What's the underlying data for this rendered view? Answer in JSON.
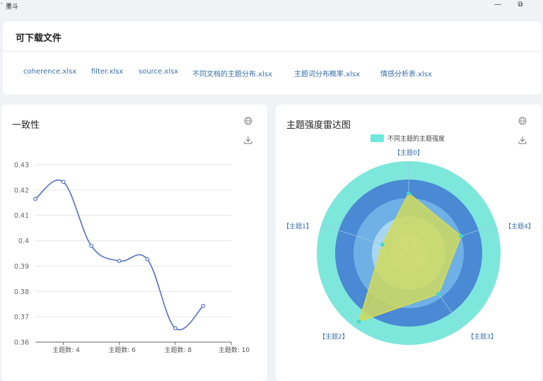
{
  "window": {
    "title": "墨斗",
    "min_icon": "—",
    "restore_icon": "⧉"
  },
  "files": {
    "title": "可下载文件",
    "links": [
      "coherence.xlsx",
      "filter.xlsx",
      "source.xlsx",
      "不同文档的主题分布.xlsx",
      "主题词分布概率.xlsx",
      "情感分析表.xlsx"
    ]
  },
  "coherence_chart": {
    "title": "一致性",
    "icons": [
      "globe-icon",
      "download-icon"
    ]
  },
  "radar_chart": {
    "title": "主题强度雷达图",
    "icons": [
      "globe-icon",
      "download-icon"
    ]
  },
  "chart_data": [
    {
      "type": "line",
      "title": "一致性",
      "x": [
        3,
        4,
        5,
        6,
        7,
        8,
        9,
        10
      ],
      "values": [
        0.4165,
        0.4232,
        0.398,
        0.392,
        0.3927,
        0.3655,
        0.3743
      ],
      "x_values": [
        3,
        4,
        5,
        6,
        7,
        8,
        9
      ],
      "x_tick_labels": [
        "主题数: 4",
        "主题数: 6",
        "主题数: 8",
        "主题数: 10"
      ],
      "x_ticks": [
        4,
        6,
        8,
        10
      ],
      "ylim": [
        0.36,
        0.43
      ],
      "y_ticks": [
        "0.36",
        "0.37",
        "0.38",
        "0.39",
        "0.4",
        "0.41",
        "0.42",
        "0.43"
      ],
      "smooth": true,
      "grid": true,
      "color": "#5470c6"
    },
    {
      "type": "radar",
      "title": "主题强度雷达图",
      "legend": "不同主题的主题强度",
      "indicators": [
        "【主题0】",
        "【主题4】",
        "【主题3】",
        "【主题2】",
        "【主题1】"
      ],
      "values": [
        0.65,
        0.6,
        0.55,
        0.92,
        0.3
      ],
      "max": 1,
      "ring_colors": [
        "#7ee7dc",
        "#4a89d4",
        "#6fb1e6",
        "#a9d6f0",
        "#cfe9f5"
      ],
      "series_color": "#cfd95e",
      "legend_color": "#6ee8dc"
    }
  ]
}
